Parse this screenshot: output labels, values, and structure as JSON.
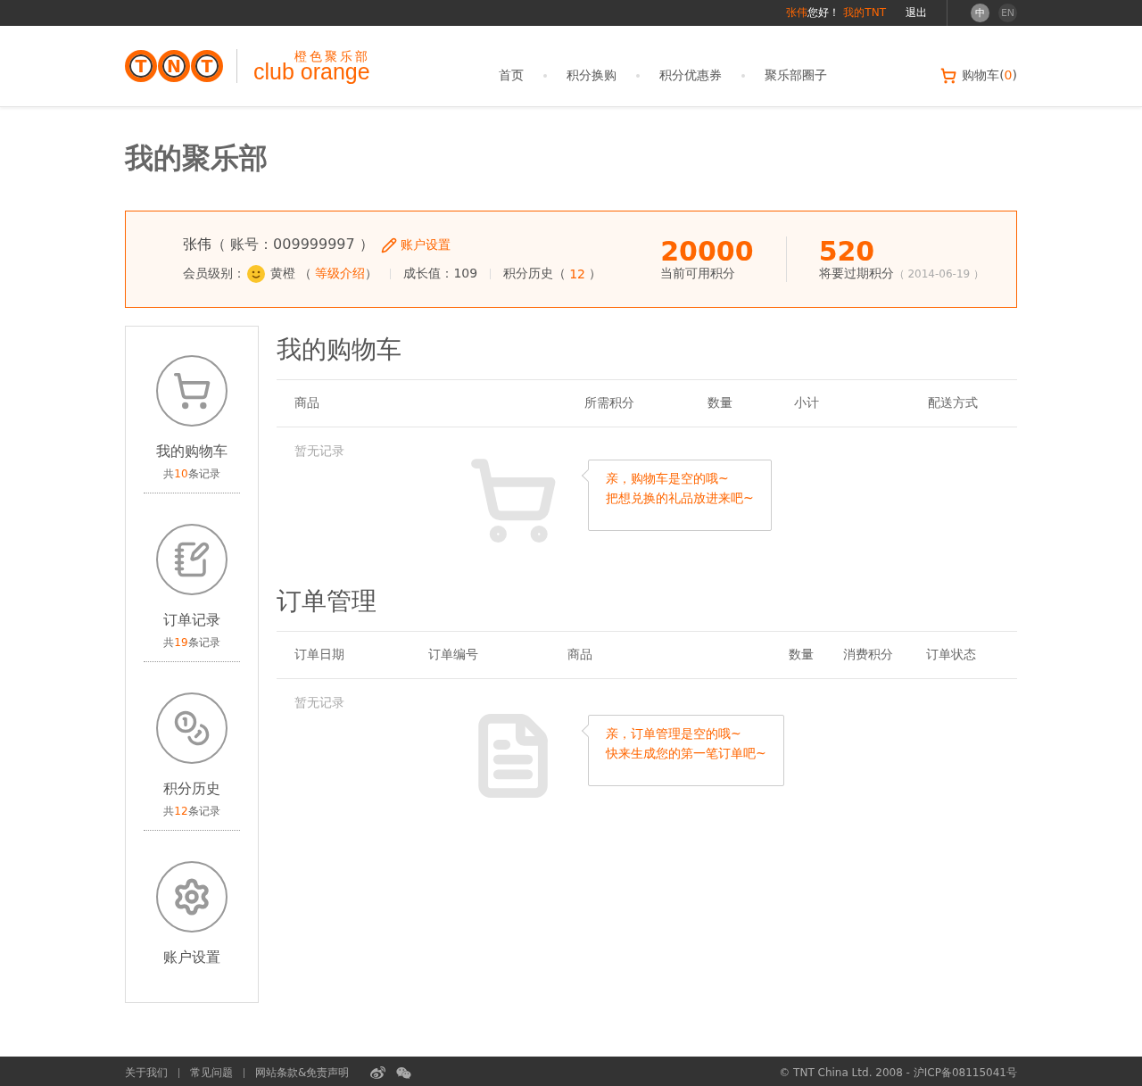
{
  "topbar": {
    "user_name": "张伟",
    "greeting": "您好！",
    "my_tnt": "我的TNT",
    "logout": "退出",
    "languages": [
      {
        "label": "中",
        "selected": true
      },
      {
        "label": "EN",
        "selected": false
      }
    ]
  },
  "header": {
    "logo_letters": [
      "T",
      "N",
      "T"
    ],
    "club_cn": "橙色聚乐部",
    "club_en": "club orange",
    "nav": [
      "首页",
      "积分换购",
      "积分优惠券",
      "聚乐部圈子"
    ],
    "cart": {
      "label": "购物车",
      "open": "(",
      "count": "0",
      "close": ")"
    }
  },
  "page_title": "我的聚乐部",
  "account": {
    "name": "张伟",
    "account_no": "（ 账号：009999997 ）",
    "settings_link": "账户设置",
    "level_label": "会员级别：",
    "level_name": "黄橙 （",
    "level_link": "等级介绍",
    "level_close": "）",
    "growth": "成长值：109",
    "history_label": "积分历史（",
    "history_count": "12",
    "history_close": "）",
    "points": [
      {
        "value": "20000",
        "label": "当前可用积分"
      },
      {
        "value": "520",
        "label": "将要过期积分",
        "note": "（ 2014-06-19 ）"
      }
    ]
  },
  "sidebar": {
    "items": [
      {
        "kind": "cart",
        "title": "我的购物车",
        "count_prefix": "共",
        "count": "10",
        "count_suffix": "条记录"
      },
      {
        "kind": "orders",
        "title": "订单记录",
        "count_prefix": "共",
        "count": "19",
        "count_suffix": "条记录"
      },
      {
        "kind": "points",
        "title": "积分历史",
        "count_prefix": "共",
        "count": "12",
        "count_suffix": "条记录"
      },
      {
        "kind": "settings",
        "title": "账户设置"
      }
    ]
  },
  "sections": [
    {
      "kind": "cart",
      "title": "我的购物车",
      "columns": [
        "商品",
        "所需积分",
        "数量",
        "小计",
        "配送方式"
      ],
      "empty_text": "暂无记录",
      "message": [
        "亲，购物车是空的哦~",
        "把想兑换的礼品放进来吧~"
      ]
    },
    {
      "kind": "orders",
      "title": "订单管理",
      "columns": [
        "订单日期",
        "订单编号",
        "商品",
        "数量",
        "消费积分",
        "订单状态"
      ],
      "empty_text": "暂无记录",
      "message": [
        "亲，订单管理是空的哦~",
        "快来生成您的第一笔订单吧~"
      ]
    }
  ],
  "footer": {
    "links": [
      "关于我们",
      "常见问题",
      "网站条款&免责声明"
    ],
    "copyright": "© TNT China Ltd. 2008 - 沪ICP备08115041号"
  }
}
